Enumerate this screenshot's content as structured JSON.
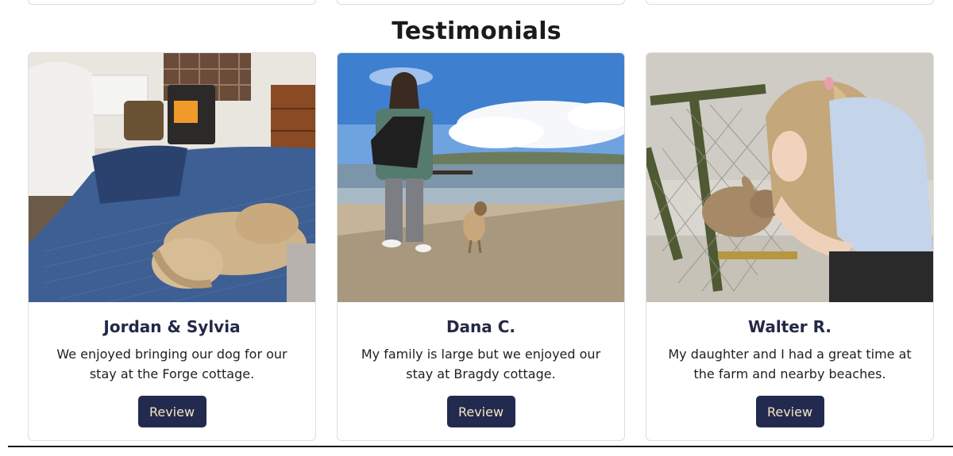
{
  "section": {
    "title": "Testimonials"
  },
  "testimonials": [
    {
      "name": "Jordan & Sylvia",
      "quote": "We enjoyed bringing our dog for our stay at the Forge cottage.",
      "button": "Review",
      "photo": "dog-on-sofa-by-wood-stove"
    },
    {
      "name": "Dana C.",
      "quote": "My family is large but we enjoyed our stay at Bragdy cottage.",
      "button": "Review",
      "photo": "woman-and-dog-on-beach"
    },
    {
      "name": "Walter R.",
      "quote": "My daughter and I had a great time at the farm and nearby beaches.",
      "button": "Review",
      "photo": "girl-with-rabbit-at-hutch"
    }
  ],
  "colors": {
    "button_bg": "#232a4f",
    "button_text": "#f2e6bf",
    "heading": "#232946"
  }
}
